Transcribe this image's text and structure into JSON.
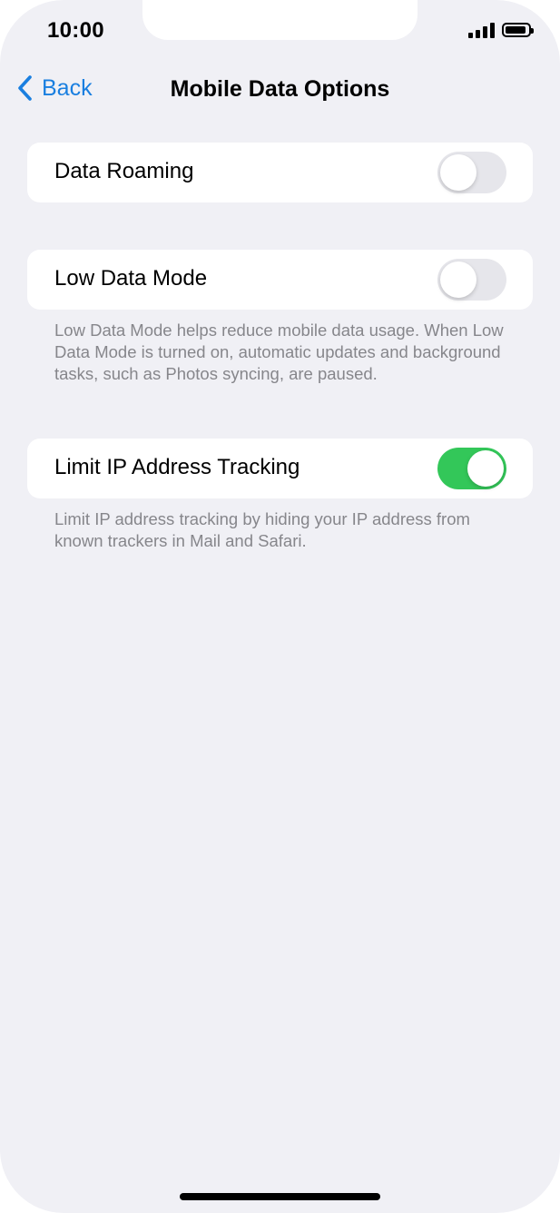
{
  "status_bar": {
    "time": "10:00",
    "battery_level_percent": 90
  },
  "nav": {
    "back_label": "Back",
    "title": "Mobile Data Options"
  },
  "rows": {
    "data_roaming": {
      "label": "Data Roaming",
      "enabled": false
    },
    "low_data_mode": {
      "label": "Low Data Mode",
      "enabled": false,
      "footnote": "Low Data Mode helps reduce mobile data usage. When Low Data Mode is turned on, automatic updates and background tasks, such as Photos syncing, are paused."
    },
    "limit_ip_tracking": {
      "label": "Limit IP Address Tracking",
      "enabled": true,
      "footnote": "Limit IP address tracking by hiding your IP address from known trackers in Mail and Safari."
    }
  },
  "colors": {
    "accent_blue": "#1a7fe0",
    "toggle_on_green": "#33c759",
    "toggle_off": "#e6e6eb",
    "background": "#f0f0f5",
    "footnote_gray": "#86868b"
  },
  "icons": {
    "back": "chevron-left-icon",
    "signal": "cellular-signal-icon",
    "battery": "battery-icon"
  }
}
